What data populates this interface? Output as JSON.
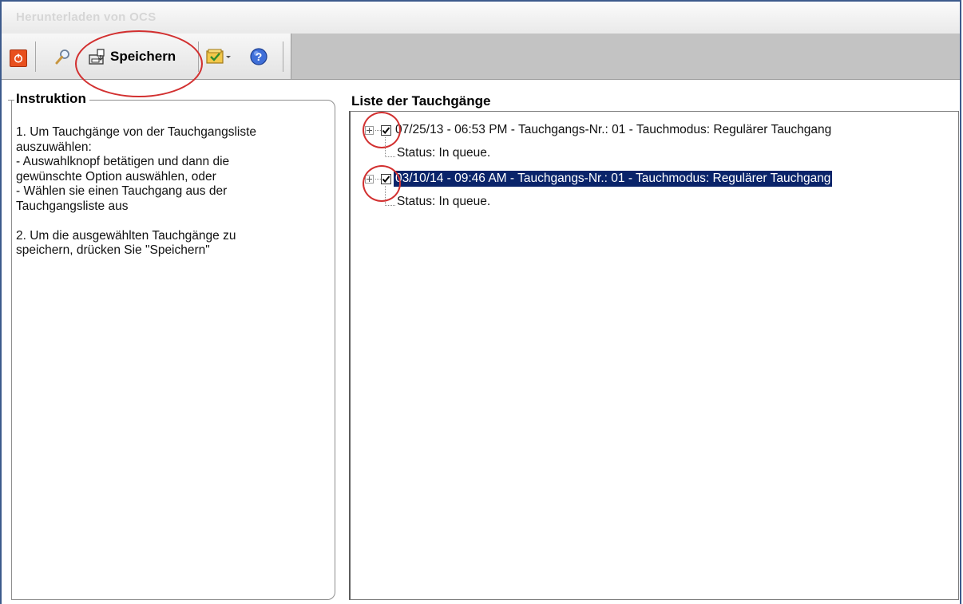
{
  "window": {
    "title": "Herunterladen von OCS"
  },
  "toolbar": {
    "power_icon": "power-icon",
    "search_icon": "magnifier-icon",
    "save_icon": "save-disk-icon",
    "save_label": "Speichern",
    "tasks_icon": "checklist-dropdown-icon",
    "help_icon": "help-icon"
  },
  "instructions": {
    "heading": "Instruktion",
    "text": "1. Um Tauchgänge von der Tauchgangsliste\nauszuwählen:\n- Auswahlknopf betätigen und dann die\ngewünschte Option auswählen, oder\n- Wählen sie einen Tauchgang aus der\nTauchgangsliste aus\n\n2. Um die ausgewählten Tauchgänge zu\nspeichern, drücken Sie \"Speichern\""
  },
  "dive_list": {
    "heading": "Liste der Tauchgänge",
    "items": [
      {
        "label": "07/25/13 - 06:53 PM - Tauchgangs-Nr.: 01 - Tauchmodus: Regulärer Tauchgang",
        "status": "Status: In queue.",
        "checked": true,
        "selected": false
      },
      {
        "label": "03/10/14 - 09:46 AM - Tauchgangs-Nr.: 01 - Tauchmodus: Regulärer Tauchgang",
        "status": "Status: In queue.",
        "checked": true,
        "selected": true
      }
    ]
  },
  "colors": {
    "selection": "#0a246a",
    "annotation": "#d23030",
    "window_border": "#3c5a8c"
  }
}
